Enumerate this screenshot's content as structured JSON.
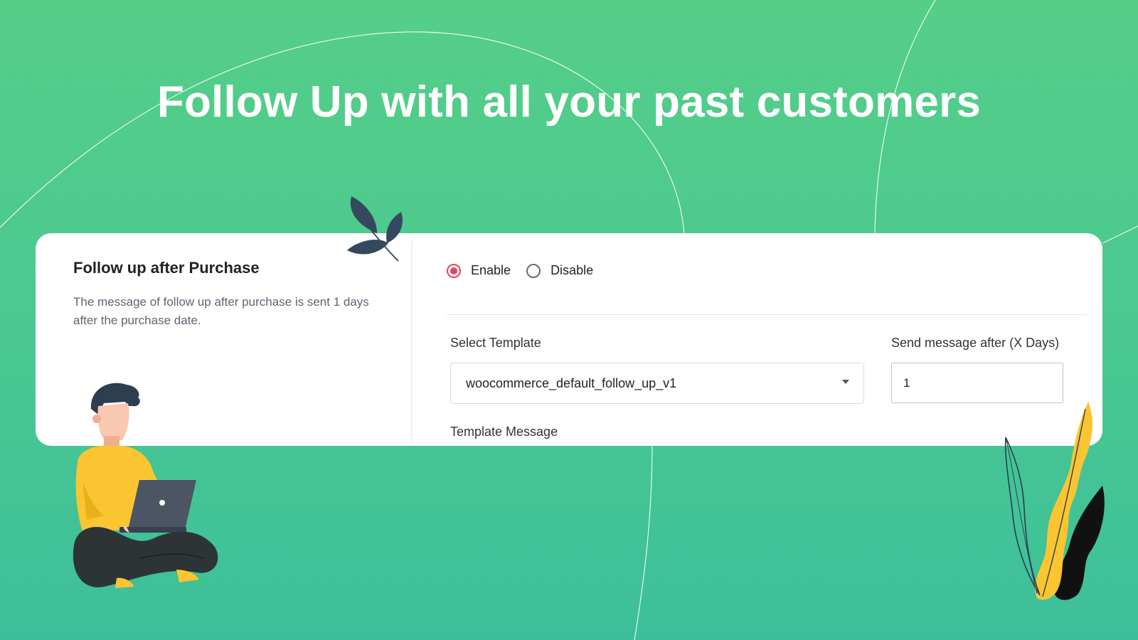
{
  "headline": "Follow Up with all your past customers",
  "card": {
    "section_title": "Follow up after Purchase",
    "section_description": "The message of follow up after purchase is sent 1 days after the purchase date.",
    "status_options": [
      {
        "label": "Enable",
        "checked": true
      },
      {
        "label": "Disable",
        "checked": false
      }
    ],
    "select_template_label": "Select Template",
    "selected_template": "woocommerce_default_follow_up_v1",
    "send_after_label": "Send message after (X Days)",
    "send_after_value": "1",
    "template_message_label": "Template Message"
  },
  "colors": {
    "background_top": "#55ce87",
    "background_bottom": "#3dbf9a",
    "radio_accent": "#e8455c",
    "shirt_yellow": "#fbc531",
    "dark_navy": "#2c3e50"
  },
  "icons": {
    "dropdown": "caret-down-icon",
    "radio_checked": "radio-checked-icon",
    "radio_unchecked": "radio-unchecked-icon"
  }
}
